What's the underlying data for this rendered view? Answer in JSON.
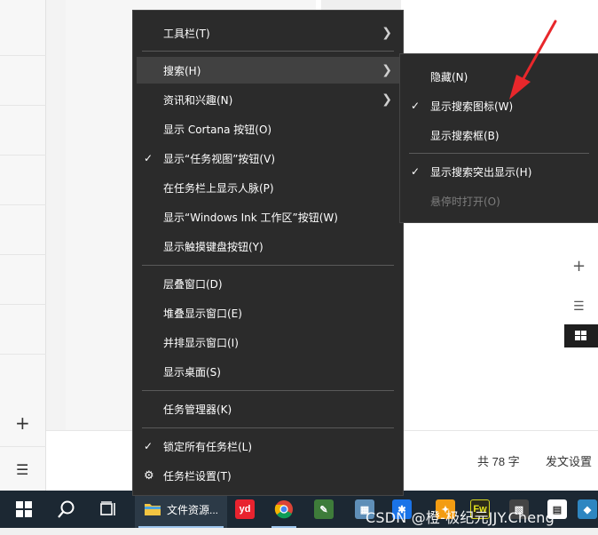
{
  "main_menu": {
    "items": [
      {
        "label": "工具栏(T)"
      },
      {
        "label": "搜索(H)"
      },
      {
        "label": "资讯和兴趣(N)"
      },
      {
        "label": "显示 Cortana 按钮(O)"
      },
      {
        "label": "显示“任务视图”按钮(V)"
      },
      {
        "label": "在任务栏上显示人脉(P)"
      },
      {
        "label": "显示“Windows Ink 工作区”按钮(W)"
      },
      {
        "label": "显示触摸键盘按钮(Y)"
      },
      {
        "label": "层叠窗口(D)"
      },
      {
        "label": "堆叠显示窗口(E)"
      },
      {
        "label": "并排显示窗口(I)"
      },
      {
        "label": "显示桌面(S)"
      },
      {
        "label": "任务管理器(K)"
      },
      {
        "label": "锁定所有任务栏(L)"
      },
      {
        "label": "任务栏设置(T)"
      }
    ]
  },
  "search_submenu": {
    "items": [
      {
        "label": "隐藏(N)"
      },
      {
        "label": "显示搜索图标(W)"
      },
      {
        "label": "显示搜索框(B)"
      },
      {
        "label": "显示搜索突出显示(H)"
      },
      {
        "label": "悬停时打开(O)"
      }
    ]
  },
  "status_bar": {
    "word_count": "共 78 字",
    "publish_settings": "发文设置"
  },
  "taskbar": {
    "file_explorer_label": "文件资源..."
  },
  "watermark": "CSDN @橙-极纪元JJY.Cheng",
  "colors": {
    "menu_bg": "#2b2b2b",
    "menu_hover": "#414141",
    "taskbar_bg": "#1c2833",
    "arrow_red": "#e8272b"
  }
}
